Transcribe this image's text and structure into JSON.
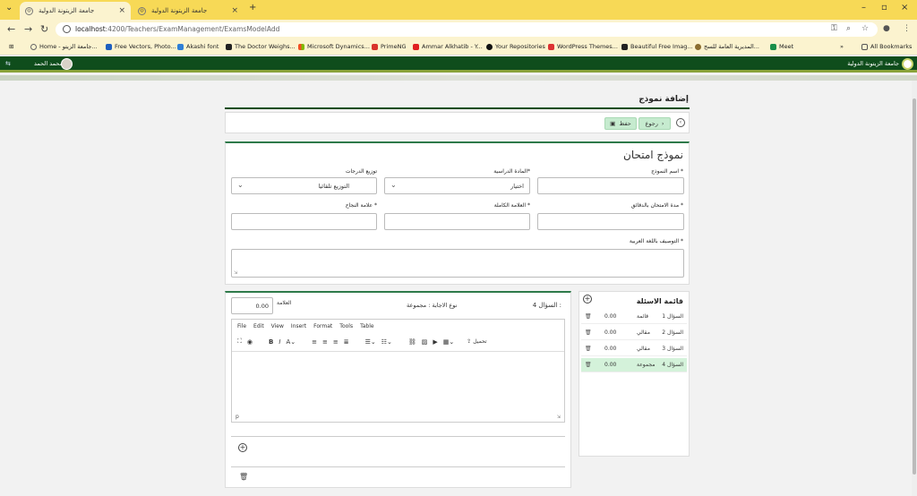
{
  "browser": {
    "tabs": [
      {
        "title": "جامعة الزيتونة الدولية",
        "active": true
      },
      {
        "title": "جامعة الزيتونة الدولية",
        "active": false
      }
    ],
    "url_host": "localhost",
    "url_path": ":4200/Teachers/ExamManagement/ExamsModelAdd",
    "bookmarks": [
      "Home - جامعة الزيتو...",
      "Free Vectors, Photo...",
      "Akashi font",
      "The Doctor Weighs...",
      "Microsoft Dynamics...",
      "PrimeNG",
      "Ammar Alkhatib - Y...",
      "Your Repositories",
      "WordPress Themes...",
      "Beautiful Free Imag...",
      "المديرية العامة للسج...",
      "Meet"
    ],
    "all_bookmarks": "All Bookmarks"
  },
  "header": {
    "university": "جامعة الزيتونة الدولية",
    "user": "محمد الحمد"
  },
  "page": {
    "title": "إضافة نموذج",
    "back_label": "رجوع",
    "save_label": "حفظ"
  },
  "form": {
    "title": "نموذج امتحان",
    "model_name_label": "اسم النموذج *",
    "subject_label": "المادة الدراسية*",
    "subject_value": "اختيار",
    "grade_dist_label": "توزيع الدرجات",
    "grade_dist_value": "التوزيع تلقائيا",
    "duration_label": "مدة الامتحان بالدقائق *",
    "full_mark_label": "العلامة الكاملة *",
    "pass_mark_label": "علامة النجاح *",
    "desc_label": "التوصيف باللغة العربية *"
  },
  "questions": {
    "title": "قائمة الاسئلة",
    "items": [
      {
        "name": "السؤال 1",
        "type": "قائمة",
        "score": "0.00"
      },
      {
        "name": "السؤال 2",
        "type": "مقالي",
        "score": "0.00"
      },
      {
        "name": "السؤال 3",
        "type": "مقالي",
        "score": "0.00"
      },
      {
        "name": "السؤال 4",
        "type": "مجموعة",
        "score": "0.00"
      }
    ],
    "selected_index": 3
  },
  "editor": {
    "question_label": "السؤال 4 :",
    "answer_type": "نوع الاجابة : مجموعة",
    "mark_label": "العلامة",
    "mark_value": "0.00",
    "menu": [
      "File",
      "Edit",
      "View",
      "Insert",
      "Format",
      "Tools",
      "Table"
    ],
    "upload_label": "تحميل",
    "status_path": "p"
  }
}
